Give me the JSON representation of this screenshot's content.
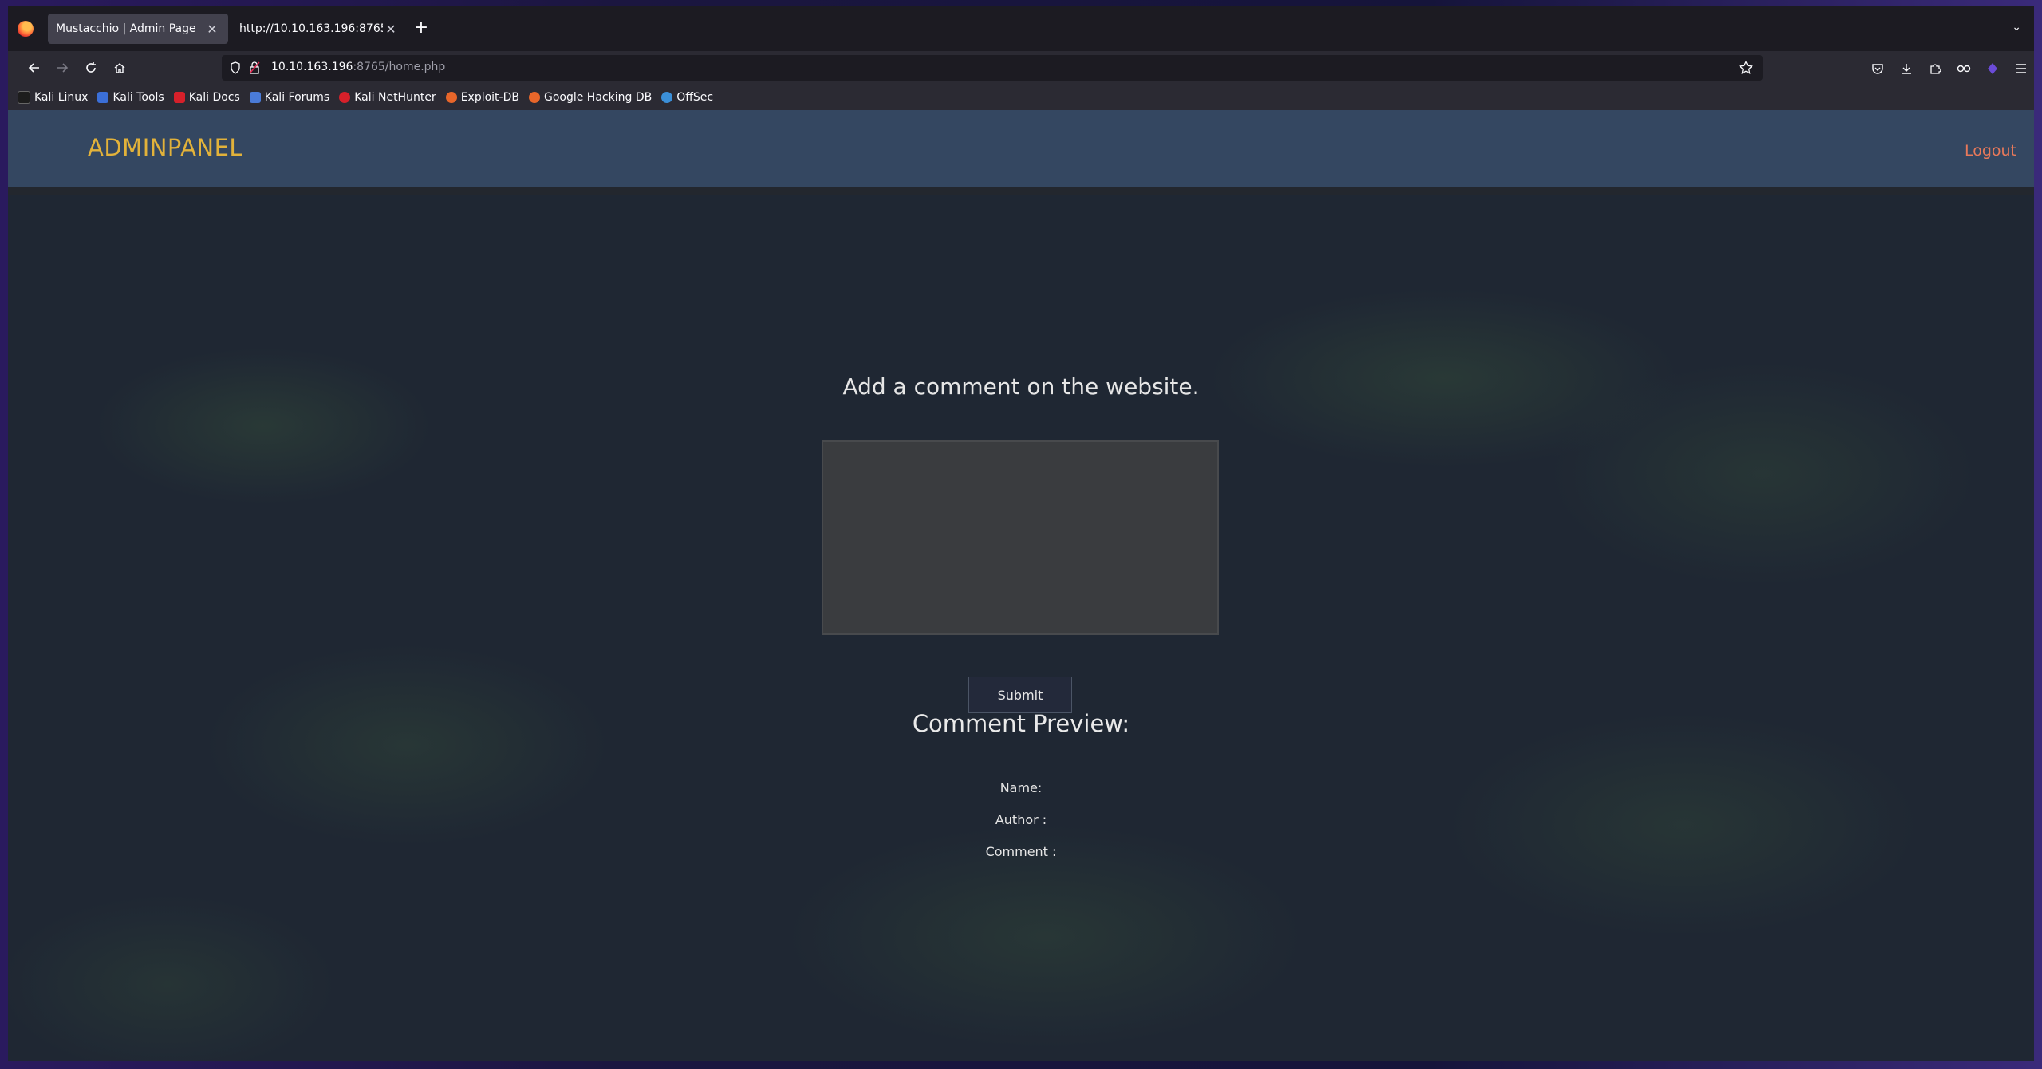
{
  "browser": {
    "tabs": [
      {
        "label": "Mustacchio | Admin Page",
        "active": true
      },
      {
        "label": "http://10.10.163.196:8765/home.php",
        "active": false
      }
    ],
    "url_host": "10.10.163.196",
    "url_path": ":8765/home.php",
    "bookmarks": [
      {
        "label": "Kali Linux",
        "icon": "kali-dragon-icon",
        "color": "#1d1d1d"
      },
      {
        "label": "Kali Tools",
        "icon": "kali-tools-icon",
        "color": "#3b6fd8"
      },
      {
        "label": "Kali Docs",
        "icon": "kali-docs-icon",
        "color": "#d6202a"
      },
      {
        "label": "Kali Forums",
        "icon": "kali-forums-icon",
        "color": "#4a7bd8"
      },
      {
        "label": "Kali NetHunter",
        "icon": "nethunter-icon",
        "color": "#d6202a"
      },
      {
        "label": "Exploit-DB",
        "icon": "exploitdb-icon",
        "color": "#e8662a"
      },
      {
        "label": "Google Hacking DB",
        "icon": "ghdb-icon",
        "color": "#e8662a"
      },
      {
        "label": "OffSec",
        "icon": "offsec-icon",
        "color": "#3b8fd8"
      }
    ]
  },
  "site": {
    "brand": "ADMINPANEL",
    "logout": "Logout",
    "title": "Add a comment on the website.",
    "comment_value": "",
    "submit_label": "Submit",
    "preview_title": "Comment Preview:",
    "name_label": "Name:",
    "author_label": "Author :",
    "comment_label": "Comment :"
  },
  "colors": {
    "brand": "#e2b23a",
    "logout": "#e8795a",
    "header": "#344761",
    "page_bg": "#1f2733"
  }
}
